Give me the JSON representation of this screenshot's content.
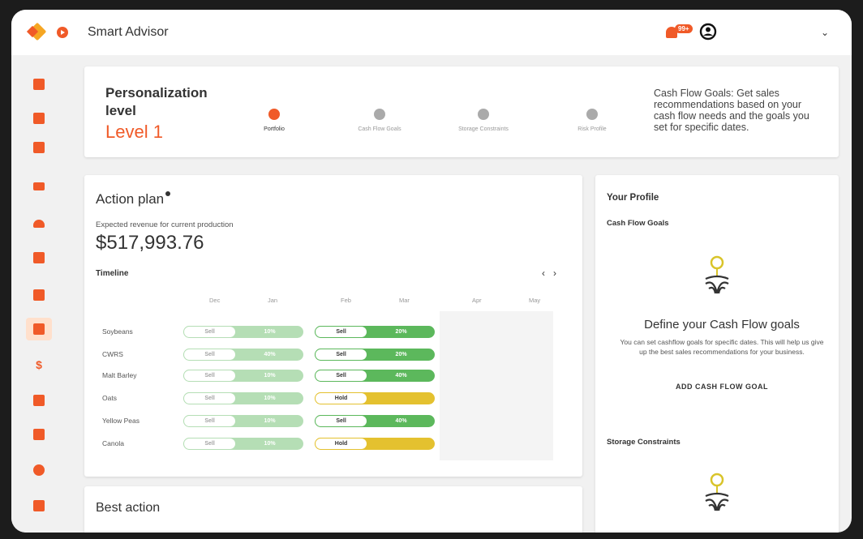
{
  "header": {
    "app_title": "Smart Advisor",
    "notification_count": "99+"
  },
  "personalization": {
    "title": "Personalization level",
    "level": "Level 1",
    "steps": [
      {
        "label": "Portfolio",
        "done": true
      },
      {
        "label": "Cash Flow Goals",
        "done": false
      },
      {
        "label": "Storage Constraints",
        "done": false
      },
      {
        "label": "Risk Profile",
        "done": false
      }
    ],
    "description": "Cash Flow Goals: Get sales recommendations based on your cash flow needs and the goals you set for specific dates."
  },
  "action_plan": {
    "title": "Action plan",
    "expected_label": "Expected revenue for current production",
    "revenue": "$517,993.76",
    "timeline_label": "Timeline",
    "months": [
      "Dec",
      "Jan",
      "Feb",
      "Mar",
      "Apr",
      "May"
    ],
    "crops": [
      {
        "name": "Soybeans",
        "past_action": "Sell",
        "past_pct": "10%",
        "action": "Sell",
        "pct": "20%",
        "type": "sell"
      },
      {
        "name": "CWRS",
        "past_action": "Sell",
        "past_pct": "40%",
        "action": "Sell",
        "pct": "20%",
        "type": "sell"
      },
      {
        "name": "Malt Barley",
        "past_action": "Sell",
        "past_pct": "10%",
        "action": "Sell",
        "pct": "40%",
        "type": "sell"
      },
      {
        "name": "Oats",
        "past_action": "Sell",
        "past_pct": "10%",
        "action": "Hold",
        "pct": "",
        "type": "hold"
      },
      {
        "name": "Yellow Peas",
        "past_action": "Sell",
        "past_pct": "10%",
        "action": "Sell",
        "pct": "40%",
        "type": "sell"
      },
      {
        "name": "Canola",
        "past_action": "Sell",
        "past_pct": "10%",
        "action": "Hold",
        "pct": "",
        "type": "hold"
      }
    ]
  },
  "profile": {
    "title": "Your Profile",
    "cash_flow_title": "Cash Flow Goals",
    "define_title": "Define your Cash Flow goals",
    "define_desc": "You can set cashflow goals for specific dates. This will help us give up the best sales recommendations for your business.",
    "add_button": "ADD CASH FLOW GOAL",
    "storage_title": "Storage Constraints"
  },
  "best_action": {
    "title": "Best action"
  },
  "colors": {
    "accent": "#f05a28",
    "sell": "#5cb85c",
    "hold": "#e4c12f"
  },
  "icons": [
    "dashboard-icon",
    "document-icon",
    "chat-icon",
    "video-icon",
    "cloud-icon",
    "news-icon",
    "chart-icon",
    "analytics-icon",
    "dollar-icon",
    "trend-icon",
    "book-icon",
    "target-icon",
    "building-icon"
  ]
}
